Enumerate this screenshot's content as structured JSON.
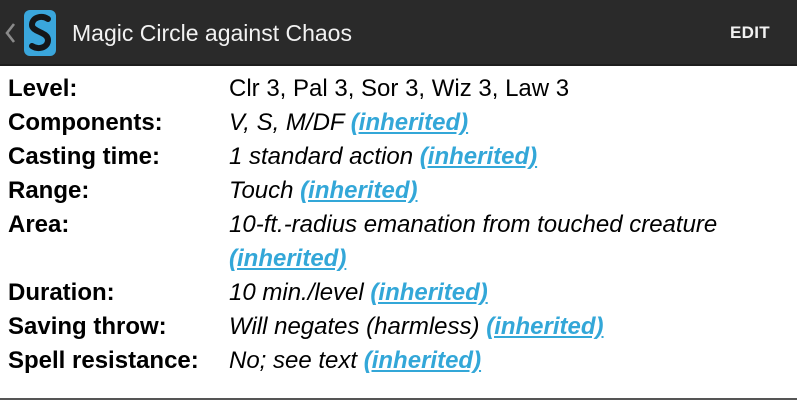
{
  "header": {
    "title": "Magic Circle against Chaos",
    "edit_label": "EDIT",
    "up_icon": "chevron-left-icon",
    "logo_icon": "app-logo-s-icon",
    "colors": {
      "bar": "#2a2a2a",
      "logo": "#3aa6dc"
    }
  },
  "spell": {
    "rows": [
      {
        "label": "Level:",
        "value": "Clr 3, Pal 3, Sor 3, Wiz 3, Law 3",
        "link": ""
      },
      {
        "label": "Components:",
        "value": "V, S, M/DF",
        "link": "(inherited)"
      },
      {
        "label": "Casting time:",
        "value": "1 standard action",
        "link": "(inherited)"
      },
      {
        "label": "Range:",
        "value": "Touch",
        "link": "(inherited)"
      },
      {
        "label": "Area:",
        "value": "10-ft.-radius emanation from touched creature",
        "link": "(inherited)"
      },
      {
        "label": "Duration:",
        "value": "10 min./level",
        "link": "(inherited)"
      },
      {
        "label": "Saving throw:",
        "value": "Will negates (harmless)",
        "link": "(inherited)"
      },
      {
        "label": "Spell resistance:",
        "value": "No; see text",
        "link": "(inherited)"
      }
    ],
    "link_color": "#33a7d8"
  }
}
